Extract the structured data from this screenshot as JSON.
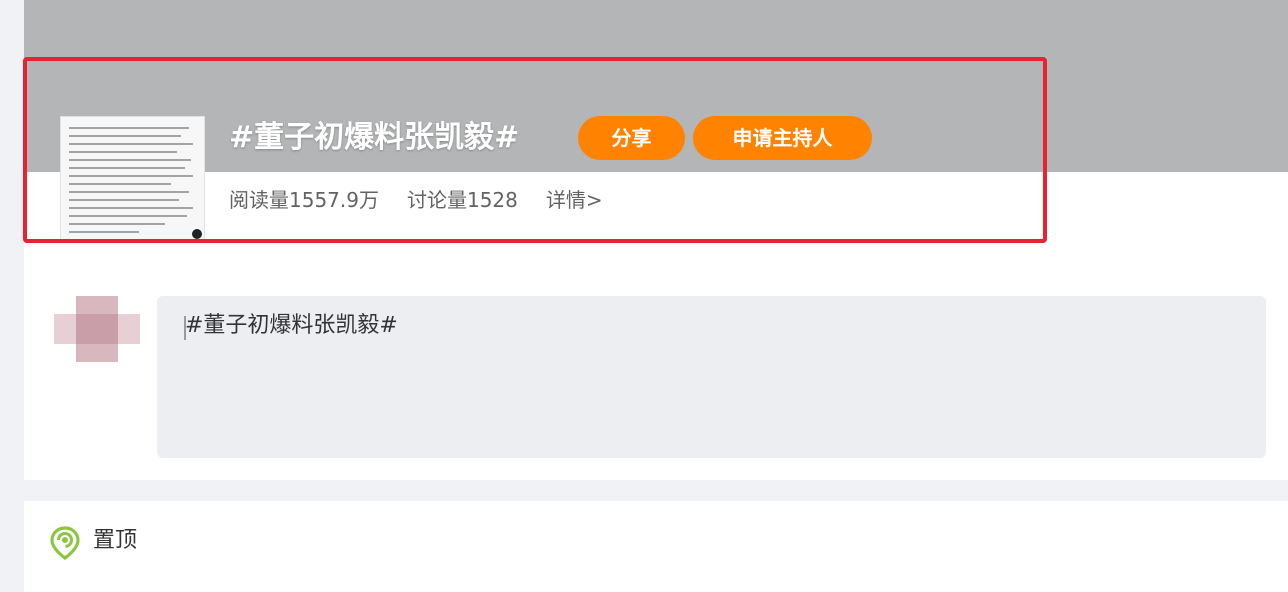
{
  "topic": {
    "title": "#董子初爆料张凯毅#",
    "share_label": "分享",
    "apply_host_label": "申请主持人",
    "reads_label": "阅读量1557.9万",
    "discussions_label": "讨论量1528",
    "details_label": "详情>"
  },
  "composer": {
    "text": "#董子初爆料张凯毅#"
  },
  "pinned": {
    "label": "置顶"
  },
  "colors": {
    "accent_orange": "#ff8200",
    "highlight_red": "#e8232f",
    "banner_gray": "#b3b5b6",
    "pin_green": "#8cc63f"
  }
}
